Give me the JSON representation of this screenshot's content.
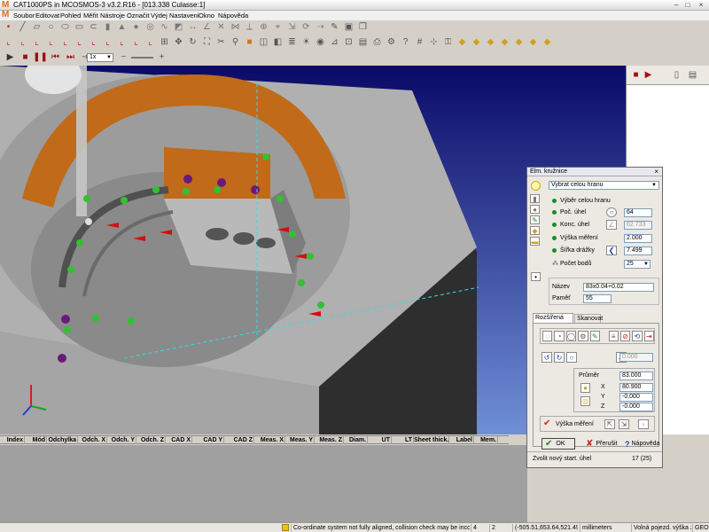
{
  "window": {
    "title": "CAT1000PS in MCOSMOS-3 v3.2.R16  - [013.338 Culasse:1]",
    "app_glyph": "M",
    "minimize": "–",
    "maximize": "□",
    "close": "×"
  },
  "menu": [
    "Soubor",
    "Editovat",
    "Pohled",
    "Měřit",
    "Nástroje",
    "Označit",
    "Výdej",
    "Nastavení",
    "Okno",
    "Nápověda"
  ],
  "toolbar_play": {
    "speed": "1x"
  },
  "table": {
    "headers": [
      "Index",
      "Mód",
      "Odchylka",
      "Odch. X",
      "Odch. Y",
      "Odch. Z",
      "CAD X",
      "CAD Y",
      "CAD Z",
      "Meas. X",
      "Meas. Y",
      "Meas. Z",
      "Diam.",
      "UT",
      "LT",
      "Sheet thick.",
      "Label",
      "Mem."
    ]
  },
  "status": {
    "message": "Co-ordinate system not fully aligned, collision check may be incorrect.",
    "count_a": "4",
    "count_b": "2",
    "coords": "(-505.51,653.64,521.49)",
    "units": "millimeters",
    "mode": "Volná pojezd. výška zap.",
    "geo": "GEO"
  },
  "dialog": {
    "title": "Elm. kružnice",
    "close": "×",
    "dropdown_value": "Vybrat celou hranu",
    "options": [
      "Výběr celou hranu",
      "Poč. úhel",
      "Konc. úhel",
      "Výška měření",
      "Šířka drážky",
      "Počet bodů"
    ],
    "values": {
      "start_angle": "64",
      "end_angle": "62.733",
      "height": "2.000",
      "groove_width": "7.499",
      "points": "25"
    },
    "name_label": "Název",
    "name_value": "83x0.04+0.02",
    "memory_label": "Paměť",
    "memory_value": "55",
    "tabs": [
      "Rozšířená opce",
      "Skanovat"
    ],
    "extra_value": "0.000",
    "diameter_label": "Průměr",
    "diameter": "83.000",
    "axes": [
      "X",
      "Y",
      "Z"
    ],
    "x": "80.900",
    "y": "-0.000",
    "z": "-0.000",
    "height_label": "Výška měření",
    "ok": "OK",
    "cancel": "Přerušit",
    "help": "Nápověda",
    "footer_text": "Zvolit nový start. úhel",
    "footer_count": "17 (25)"
  },
  "colors": {
    "sky_top": "#0a0a66",
    "sky_bottom": "#6f8fd8",
    "part": "#a8a8a8",
    "orange": "#c06a1a",
    "dark": "#2e2e2e",
    "point_green": "#33c033",
    "point_purple": "#6a1a7a",
    "vector_red": "#d01010"
  }
}
